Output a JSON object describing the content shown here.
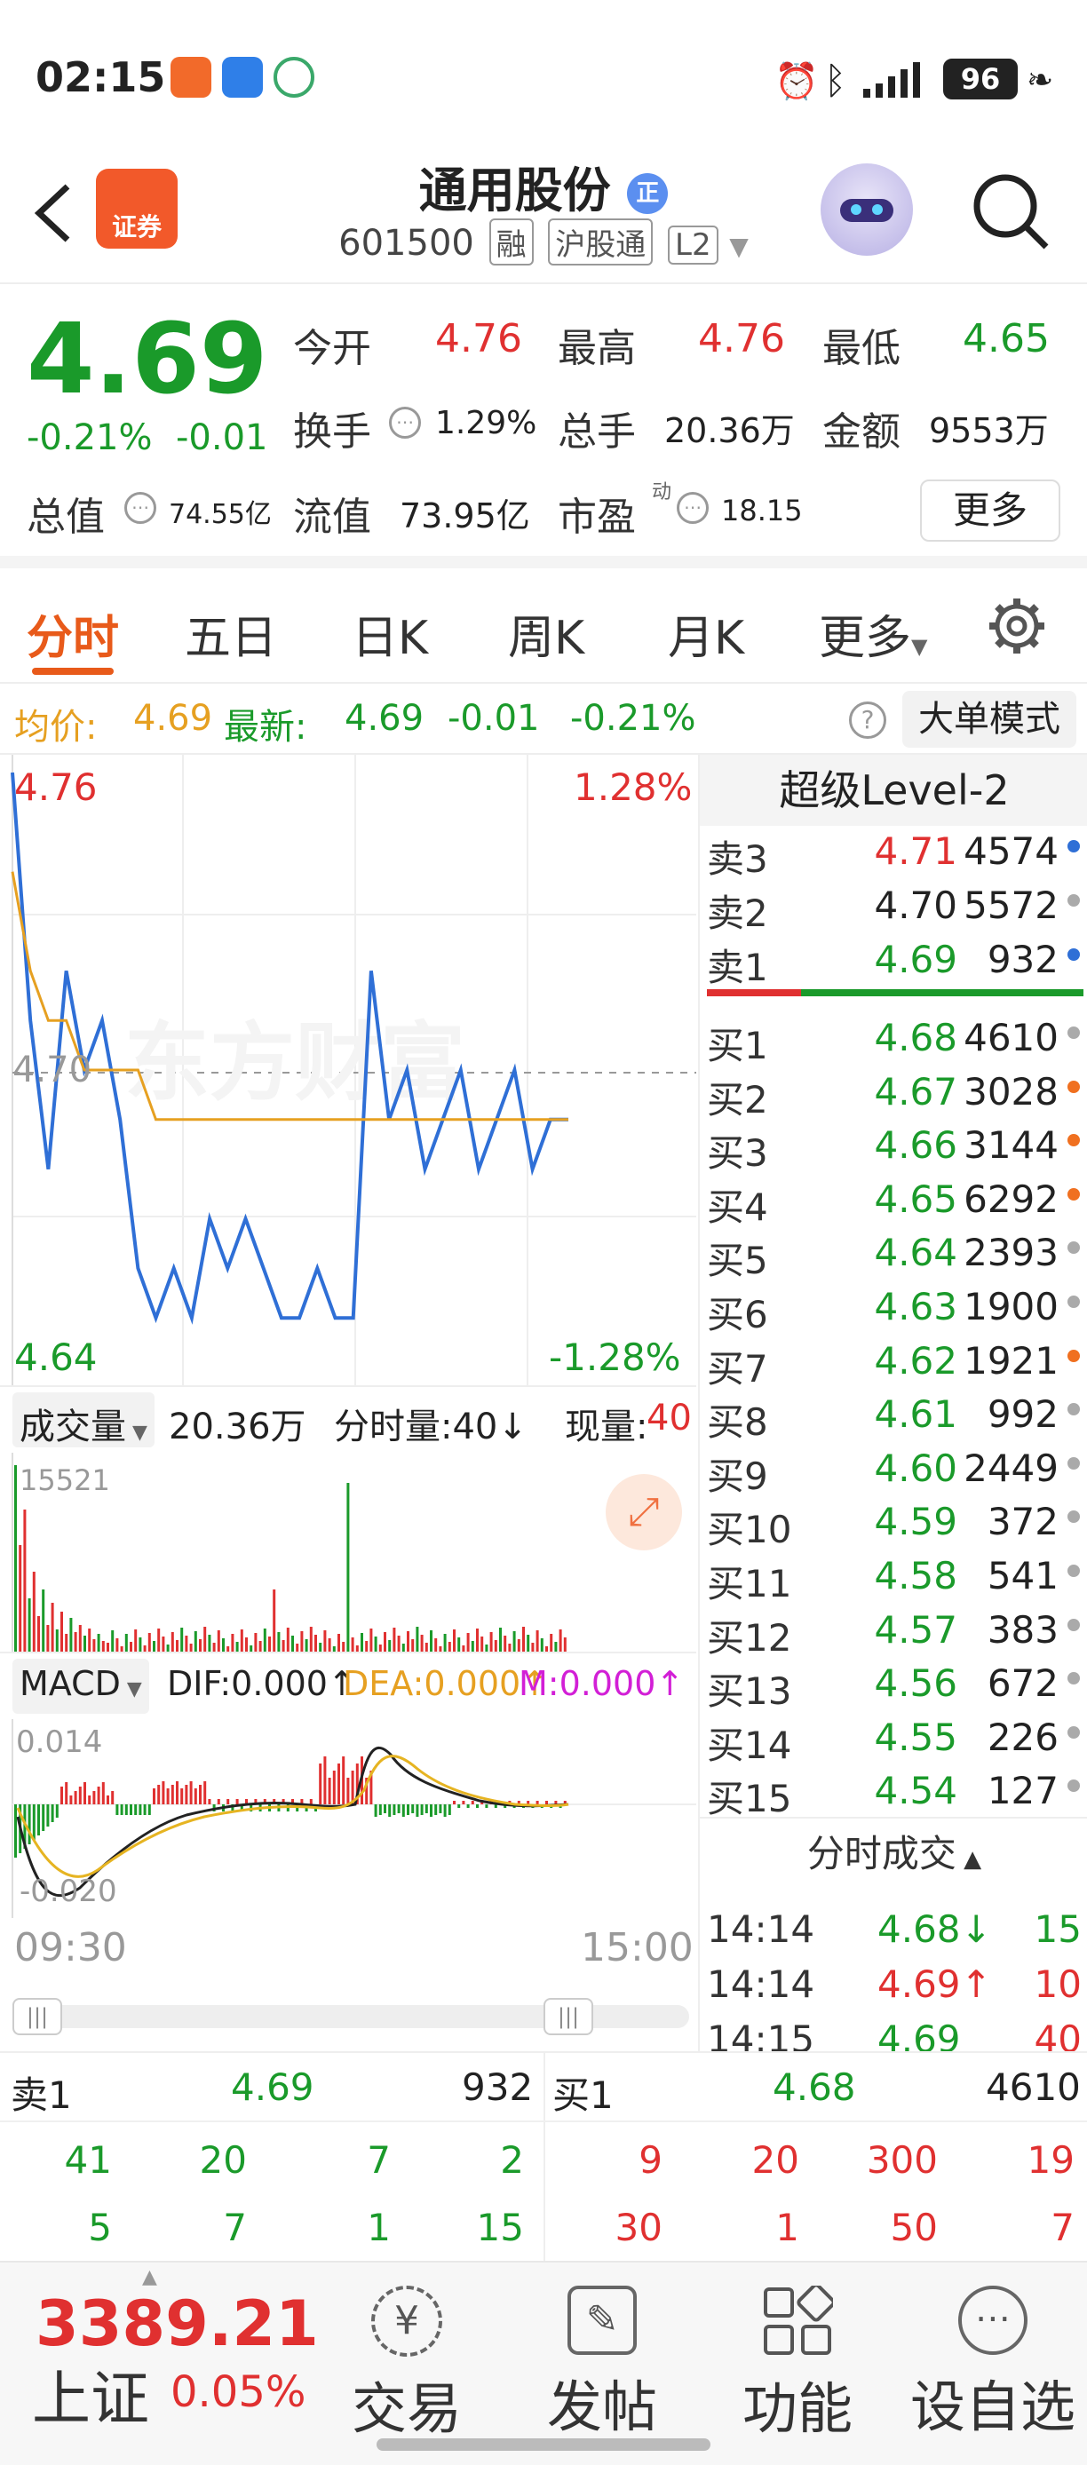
{
  "status_bar": {
    "time": "02:15",
    "battery": "96"
  },
  "header": {
    "broker_badge": "证券",
    "stock_name": "通用股份",
    "name_badge": "正",
    "stock_code": "601500",
    "tags": [
      "融",
      "沪股通",
      "L2"
    ]
  },
  "quote": {
    "price": "4.69",
    "change_pct": "-0.21%",
    "change": "-0.01",
    "open_label": "今开",
    "open": "4.76",
    "high_label": "最高",
    "high": "4.76",
    "low_label": "最低",
    "low": "4.65",
    "turnover_label": "换手",
    "turnover": "1.29%",
    "volume_label": "总手",
    "volume": "20.36万",
    "amount_label": "金额",
    "amount": "9553万",
    "mktcap_label": "总值",
    "mktcap": "74.55亿",
    "float_label": "流值",
    "float_cap": "73.95亿",
    "pe_label": "市盈",
    "pe_sup": "动",
    "pe": "18.15",
    "more_button": "更多"
  },
  "tabs": {
    "items": [
      "分时",
      "五日",
      "日K",
      "周K",
      "月K",
      "更多"
    ],
    "active": "分时"
  },
  "info_strip": {
    "avg_label": "均价:",
    "avg": "4.69",
    "latest_label": "最新:",
    "latest": "4.69",
    "change": "-0.01",
    "change_pct": "-0.21%",
    "big_order_button": "大单模式"
  },
  "chart": {
    "price_top": "4.76",
    "price_bottom": "4.64",
    "pct_top": "1.28%",
    "pct_bottom": "-1.28%",
    "mid_price": "4.70",
    "watermark": "东方财富",
    "volume_label": "成交量",
    "volume_total": "20.36万",
    "tick_vol_label": "分时量:40↓",
    "current_vol_label": "现量:",
    "current_vol": "40",
    "volume_max": "15521",
    "macd_label": "MACD",
    "dif": "DIF:0.000↑",
    "dea": "DEA:0.000↑",
    "m": "M:0.000↑",
    "macd_top": "0.014",
    "macd_bottom": "-0.020",
    "time_start": "09:30",
    "time_end": "15:00"
  },
  "chart_data": {
    "type": "line",
    "title": "",
    "x": [
      "09:30",
      "15:00"
    ],
    "price_range": [
      4.64,
      4.76
    ],
    "series": [
      {
        "name": "",
        "color": "#2f6fd6",
        "values": [
          4.76,
          4.71,
          4.68,
          4.72,
          4.7,
          4.71,
          4.69,
          4.66,
          4.65,
          4.66,
          4.65,
          4.67,
          4.66,
          4.67,
          4.66,
          4.65,
          4.65,
          4.66,
          4.65,
          4.65,
          4.72,
          4.69,
          4.7,
          4.68,
          4.69,
          4.7,
          4.68,
          4.69,
          4.7,
          4.68,
          4.69,
          4.69
        ]
      },
      {
        "name": "均价",
        "color": "#e6a021",
        "values": [
          4.74,
          4.72,
          4.71,
          4.71,
          4.7,
          4.7,
          4.7,
          4.7,
          4.69,
          4.69,
          4.69,
          4.69,
          4.69,
          4.69,
          4.69,
          4.69,
          4.69,
          4.69,
          4.69,
          4.69,
          4.69,
          4.69,
          4.69,
          4.69,
          4.69,
          4.69,
          4.69,
          4.69,
          4.69,
          4.69,
          4.69,
          4.69
        ]
      }
    ]
  },
  "orderbook": {
    "title": "超级Level-2",
    "sells": [
      {
        "label": "卖3",
        "price": "4.71",
        "vol": "4574",
        "pc": "red",
        "dot": "#2f6fd6"
      },
      {
        "label": "卖2",
        "price": "4.70",
        "vol": "5572",
        "pc": "black",
        "dot": "#aaaaaa"
      },
      {
        "label": "卖1",
        "price": "4.69",
        "vol": "932",
        "pc": "green",
        "dot": "#2f6fd6"
      }
    ],
    "buys": [
      {
        "label": "买1",
        "price": "4.68",
        "vol": "4610",
        "dot": "#aaaaaa"
      },
      {
        "label": "买2",
        "price": "4.67",
        "vol": "3028",
        "dot": "#f07020"
      },
      {
        "label": "买3",
        "price": "4.66",
        "vol": "3144",
        "dot": "#f07020"
      },
      {
        "label": "买4",
        "price": "4.65",
        "vol": "6292",
        "dot": "#f07020"
      },
      {
        "label": "买5",
        "price": "4.64",
        "vol": "2393",
        "dot": "#aaaaaa"
      },
      {
        "label": "买6",
        "price": "4.63",
        "vol": "1900",
        "dot": "#aaaaaa"
      },
      {
        "label": "买7",
        "price": "4.62",
        "vol": "1921",
        "dot": "#f07020"
      },
      {
        "label": "买8",
        "price": "4.61",
        "vol": "992",
        "dot": "#aaaaaa"
      },
      {
        "label": "买9",
        "price": "4.60",
        "vol": "2449",
        "dot": "#aaaaaa"
      },
      {
        "label": "买10",
        "price": "4.59",
        "vol": "372",
        "dot": "#aaaaaa"
      },
      {
        "label": "买11",
        "price": "4.58",
        "vol": "541",
        "dot": "#aaaaaa"
      },
      {
        "label": "买12",
        "price": "4.57",
        "vol": "383",
        "dot": "#aaaaaa"
      },
      {
        "label": "买13",
        "price": "4.56",
        "vol": "672",
        "dot": "#aaaaaa"
      },
      {
        "label": "买14",
        "price": "4.55",
        "vol": "226",
        "dot": "#aaaaaa"
      },
      {
        "label": "买15",
        "price": "4.54",
        "vol": "127",
        "dot": "#aaaaaa"
      }
    ],
    "trades_title": "分时成交",
    "trades": [
      {
        "time": "14:14",
        "price": "4.68↓",
        "vol": "15",
        "pc": "green",
        "vc": "green"
      },
      {
        "time": "14:14",
        "price": "4.69↑",
        "vol": "10",
        "pc": "red",
        "vc": "red"
      },
      {
        "time": "14:15",
        "price": "4.69",
        "vol": "40",
        "pc": "green",
        "vc": "red"
      }
    ]
  },
  "bottom_book": {
    "sell_label": "卖1",
    "sell_price": "4.69",
    "sell_vol": "932",
    "buy_label": "买1",
    "buy_price": "4.68",
    "buy_vol": "4610",
    "sell_queue_1": [
      "41",
      "20",
      "7",
      "2"
    ],
    "sell_queue_2": [
      "5",
      "7",
      "1",
      "15"
    ],
    "buy_queue_1": [
      "9",
      "20",
      "300",
      "19"
    ],
    "buy_queue_2": [
      "30",
      "1",
      "50",
      "7"
    ]
  },
  "bottom_nav": {
    "index_value": "3389.21",
    "index_name": "上证",
    "index_change": "0.05%",
    "items": [
      "交易",
      "发帖",
      "功能",
      "设自选"
    ]
  }
}
